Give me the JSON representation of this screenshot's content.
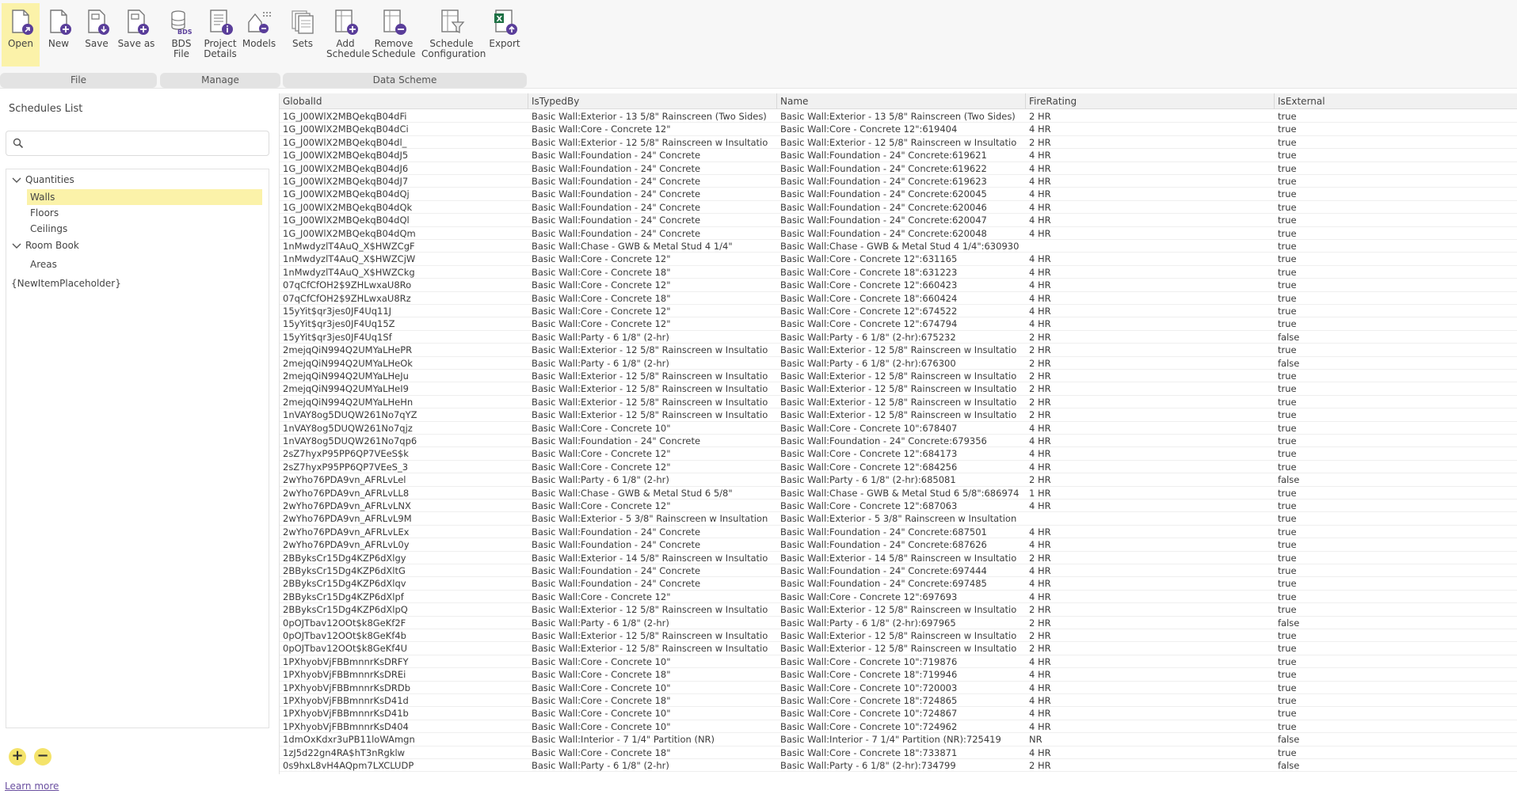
{
  "ribbon": {
    "tools": [
      {
        "name": "open",
        "label": "Open",
        "icon": "open-file-icon"
      },
      {
        "name": "new",
        "label": "New",
        "icon": "new-file-icon"
      },
      {
        "name": "save",
        "label": "Save",
        "icon": "save-icon"
      },
      {
        "name": "save-as",
        "label": "Save as",
        "icon": "save-as-icon"
      },
      {
        "name": "bds-file",
        "label": "BDS\nFile",
        "icon": "bds-database-icon"
      },
      {
        "name": "project-details",
        "label": "Project\nDetails",
        "icon": "project-details-icon"
      },
      {
        "name": "models",
        "label": "Models",
        "icon": "models-icon"
      },
      {
        "name": "sets",
        "label": "Sets",
        "icon": "sets-icon"
      },
      {
        "name": "add-schedule",
        "label": "Add\nSchedule",
        "icon": "add-schedule-icon"
      },
      {
        "name": "remove-schedule",
        "label": "Remove\nSchedule",
        "icon": "remove-schedule-icon"
      },
      {
        "name": "schedule-configuration",
        "label": "Schedule\nConfiguration",
        "icon": "schedule-configuration-icon"
      },
      {
        "name": "export",
        "label": "Export",
        "icon": "excel-export-icon"
      }
    ],
    "groups": [
      "File",
      "Manage",
      "Data Scheme"
    ]
  },
  "left_panel": {
    "title": "Schedules List",
    "search": {
      "value": "",
      "placeholder": ""
    },
    "tree": {
      "quantities": {
        "label": "Quantities",
        "children": [
          "Walls",
          "Floors",
          "Ceilings"
        ]
      },
      "room_book": {
        "label": "Room Book",
        "children": [
          "Areas"
        ]
      },
      "placeholder": "{NewItemPlaceholder}"
    },
    "selected": "Walls",
    "add_button": "+",
    "remove_button": "−",
    "learn_more": "Learn more"
  },
  "grid": {
    "columns": [
      "GlobalId",
      "IsTypedBy",
      "Name",
      "FireRating",
      "IsExternal"
    ],
    "rows": [
      [
        "1G_J00WlX2MBQekqB04dFi",
        "Basic Wall:Exterior - 13 5/8\" Rainscreen (Two Sides)",
        "Basic Wall:Exterior - 13 5/8\" Rainscreen (Two Sides)",
        "2 HR",
        "true"
      ],
      [
        "1G_J00WlX2MBQekqB04dCi",
        "Basic Wall:Core - Concrete 12\"",
        "Basic Wall:Core - Concrete 12\":619404",
        "4 HR",
        "true"
      ],
      [
        "1G_J00WlX2MBQekqB04dl_",
        "Basic Wall:Exterior - 12 5/8\" Rainscreen w Insultatio",
        "Basic Wall:Exterior - 12 5/8\" Rainscreen w Insultatio",
        "2 HR",
        "true"
      ],
      [
        "1G_J00WlX2MBQekqB04dJ5",
        "Basic Wall:Foundation - 24\" Concrete",
        "Basic Wall:Foundation - 24\" Concrete:619621",
        "4 HR",
        "true"
      ],
      [
        "1G_J00WlX2MBQekqB04dJ6",
        "Basic Wall:Foundation - 24\" Concrete",
        "Basic Wall:Foundation - 24\" Concrete:619622",
        "4 HR",
        "true"
      ],
      [
        "1G_J00WlX2MBQekqB04dJ7",
        "Basic Wall:Foundation - 24\" Concrete",
        "Basic Wall:Foundation - 24\" Concrete:619623",
        "4 HR",
        "true"
      ],
      [
        "1G_J00WlX2MBQekqB04dQj",
        "Basic Wall:Foundation - 24\" Concrete",
        "Basic Wall:Foundation - 24\" Concrete:620045",
        "4 HR",
        "true"
      ],
      [
        "1G_J00WlX2MBQekqB04dQk",
        "Basic Wall:Foundation - 24\" Concrete",
        "Basic Wall:Foundation - 24\" Concrete:620046",
        "4 HR",
        "true"
      ],
      [
        "1G_J00WlX2MBQekqB04dQl",
        "Basic Wall:Foundation - 24\" Concrete",
        "Basic Wall:Foundation - 24\" Concrete:620047",
        "4 HR",
        "true"
      ],
      [
        "1G_J00WlX2MBQekqB04dQm",
        "Basic Wall:Foundation - 24\" Concrete",
        "Basic Wall:Foundation - 24\" Concrete:620048",
        "4 HR",
        "true"
      ],
      [
        "1nMwdyzlT4AuQ_X$HWZCgF",
        "Basic Wall:Chase - GWB & Metal Stud 4 1/4\"",
        "Basic Wall:Chase - GWB & Metal Stud 4 1/4\":630930",
        "",
        "true"
      ],
      [
        "1nMwdyzlT4AuQ_X$HWZCjW",
        "Basic Wall:Core - Concrete 12\"",
        "Basic Wall:Core - Concrete 12\":631165",
        "4 HR",
        "true"
      ],
      [
        "1nMwdyzlT4AuQ_X$HWZCkg",
        "Basic Wall:Core - Concrete 18\"",
        "Basic Wall:Core - Concrete 18\":631223",
        "4 HR",
        "true"
      ],
      [
        "07qCfCfOH2$9ZHLwxaU8Ro",
        "Basic Wall:Core - Concrete 12\"",
        "Basic Wall:Core - Concrete 12\":660423",
        "4 HR",
        "true"
      ],
      [
        "07qCfCfOH2$9ZHLwxaU8Rz",
        "Basic Wall:Core - Concrete 18\"",
        "Basic Wall:Core - Concrete 18\":660424",
        "4 HR",
        "true"
      ],
      [
        "15yYit$qr3jes0JF4Uq11J",
        "Basic Wall:Core - Concrete 12\"",
        "Basic Wall:Core - Concrete 12\":674522",
        "4 HR",
        "true"
      ],
      [
        "15yYit$qr3jes0JF4Uq15Z",
        "Basic Wall:Core - Concrete 12\"",
        "Basic Wall:Core - Concrete 12\":674794",
        "4 HR",
        "true"
      ],
      [
        "15yYit$qr3jes0JF4Uq1Sf",
        "Basic Wall:Party - 6 1/8\" (2-hr)",
        "Basic Wall:Party - 6 1/8\" (2-hr):675232",
        "2 HR",
        "false"
      ],
      [
        "2mejqQiN994Q2UMYaLHePR",
        "Basic Wall:Exterior - 12 5/8\" Rainscreen w Insultatio",
        "Basic Wall:Exterior - 12 5/8\" Rainscreen w Insultatio",
        "2 HR",
        "true"
      ],
      [
        "2mejqQiN994Q2UMYaLHeOk",
        "Basic Wall:Party - 6 1/8\" (2-hr)",
        "Basic Wall:Party - 6 1/8\" (2-hr):676300",
        "2 HR",
        "false"
      ],
      [
        "2mejqQiN994Q2UMYaLHeJu",
        "Basic Wall:Exterior - 12 5/8\" Rainscreen w Insultatio",
        "Basic Wall:Exterior - 12 5/8\" Rainscreen w Insultatio",
        "2 HR",
        "true"
      ],
      [
        "2mejqQiN994Q2UMYaLHeI9",
        "Basic Wall:Exterior - 12 5/8\" Rainscreen w Insultatio",
        "Basic Wall:Exterior - 12 5/8\" Rainscreen w Insultatio",
        "2 HR",
        "true"
      ],
      [
        "2mejqQiN994Q2UMYaLHeHn",
        "Basic Wall:Exterior - 12 5/8\" Rainscreen w Insultatio",
        "Basic Wall:Exterior - 12 5/8\" Rainscreen w Insultatio",
        "2 HR",
        "true"
      ],
      [
        "1nVAY8og5DUQW261No7qYZ",
        "Basic Wall:Exterior - 12 5/8\" Rainscreen w Insultatio",
        "Basic Wall:Exterior - 12 5/8\" Rainscreen w Insultatio",
        "2 HR",
        "true"
      ],
      [
        "1nVAY8og5DUQW261No7qjz",
        "Basic Wall:Core - Concrete 10\"",
        "Basic Wall:Core - Concrete 10\":678407",
        "4 HR",
        "true"
      ],
      [
        "1nVAY8og5DUQW261No7qp6",
        "Basic Wall:Foundation - 24\" Concrete",
        "Basic Wall:Foundation - 24\" Concrete:679356",
        "4 HR",
        "true"
      ],
      [
        "2sZ7hyxP95PP6QP7VEeS$k",
        "Basic Wall:Core - Concrete 12\"",
        "Basic Wall:Core - Concrete 12\":684173",
        "4 HR",
        "true"
      ],
      [
        "2sZ7hyxP95PP6QP7VEeS_3",
        "Basic Wall:Core - Concrete 12\"",
        "Basic Wall:Core - Concrete 12\":684256",
        "4 HR",
        "true"
      ],
      [
        "2wYho76PDA9vn_AFRLvLel",
        "Basic Wall:Party - 6 1/8\" (2-hr)",
        "Basic Wall:Party - 6 1/8\" (2-hr):685081",
        "2 HR",
        "false"
      ],
      [
        "2wYho76PDA9vn_AFRLvLL8",
        "Basic Wall:Chase - GWB & Metal Stud 6 5/8\"",
        "Basic Wall:Chase - GWB & Metal Stud 6 5/8\":686974",
        "1 HR",
        "true"
      ],
      [
        "2wYho76PDA9vn_AFRLvLNX",
        "Basic Wall:Core - Concrete 12\"",
        "Basic Wall:Core - Concrete 12\":687063",
        "4 HR",
        "true"
      ],
      [
        "2wYho76PDA9vn_AFRLvL9M",
        "Basic Wall:Exterior - 5 3/8\" Rainscreen w Insultation",
        "Basic Wall:Exterior - 5 3/8\" Rainscreen w Insultation",
        "",
        "true"
      ],
      [
        "2wYho76PDA9vn_AFRLvLEx",
        "Basic Wall:Foundation - 24\" Concrete",
        "Basic Wall:Foundation - 24\" Concrete:687501",
        "4 HR",
        "true"
      ],
      [
        "2wYho76PDA9vn_AFRLvL0y",
        "Basic Wall:Foundation - 24\" Concrete",
        "Basic Wall:Foundation - 24\" Concrete:687626",
        "4 HR",
        "true"
      ],
      [
        "2BByksCr15Dg4KZP6dXlgy",
        "Basic Wall:Exterior - 14 5/8\" Rainscreen w Insultatio",
        "Basic Wall:Exterior - 14 5/8\" Rainscreen w Insultatio",
        "2 HR",
        "true"
      ],
      [
        "2BByksCr15Dg4KZP6dXltG",
        "Basic Wall:Foundation - 24\" Concrete",
        "Basic Wall:Foundation - 24\" Concrete:697444",
        "4 HR",
        "true"
      ],
      [
        "2BByksCr15Dg4KZP6dXlqv",
        "Basic Wall:Foundation - 24\" Concrete",
        "Basic Wall:Foundation - 24\" Concrete:697485",
        "4 HR",
        "true"
      ],
      [
        "2BByksCr15Dg4KZP6dXlpf",
        "Basic Wall:Core - Concrete 12\"",
        "Basic Wall:Core - Concrete 12\":697693",
        "4 HR",
        "true"
      ],
      [
        "2BByksCr15Dg4KZP6dXlpQ",
        "Basic Wall:Exterior - 12 5/8\" Rainscreen w Insultatio",
        "Basic Wall:Exterior - 12 5/8\" Rainscreen w Insultatio",
        "2 HR",
        "true"
      ],
      [
        "0pOJTbav12OOt$k8GeKf2F",
        "Basic Wall:Party - 6 1/8\" (2-hr)",
        "Basic Wall:Party - 6 1/8\" (2-hr):697965",
        "2 HR",
        "false"
      ],
      [
        "0pOJTbav12OOt$k8GeKf4b",
        "Basic Wall:Exterior - 12 5/8\" Rainscreen w Insultatio",
        "Basic Wall:Exterior - 12 5/8\" Rainscreen w Insultatio",
        "2 HR",
        "true"
      ],
      [
        "0pOJTbav12OOt$k8GeKf4U",
        "Basic Wall:Exterior - 12 5/8\" Rainscreen w Insultatio",
        "Basic Wall:Exterior - 12 5/8\" Rainscreen w Insultatio",
        "2 HR",
        "true"
      ],
      [
        "1PXhyobVjFBBmnnrKsDRFY",
        "Basic Wall:Core - Concrete 10\"",
        "Basic Wall:Core - Concrete 10\":719876",
        "4 HR",
        "true"
      ],
      [
        "1PXhyobVjFBBmnnrKsDREi",
        "Basic Wall:Core - Concrete 18\"",
        "Basic Wall:Core - Concrete 18\":719946",
        "4 HR",
        "true"
      ],
      [
        "1PXhyobVjFBBmnnrKsDRDb",
        "Basic Wall:Core - Concrete 10\"",
        "Basic Wall:Core - Concrete 10\":720003",
        "4 HR",
        "true"
      ],
      [
        "1PXhyobVjFBBmnnrKsD41d",
        "Basic Wall:Core - Concrete 18\"",
        "Basic Wall:Core - Concrete 18\":724865",
        "4 HR",
        "true"
      ],
      [
        "1PXhyobVjFBBmnnrKsD41b",
        "Basic Wall:Core - Concrete 10\"",
        "Basic Wall:Core - Concrete 10\":724867",
        "4 HR",
        "true"
      ],
      [
        "1PXhyobVjFBBmnnrKsD404",
        "Basic Wall:Core - Concrete 10\"",
        "Basic Wall:Core - Concrete 10\":724962",
        "4 HR",
        "true"
      ],
      [
        "1dmOxKdxr3uPB11loWAmgn",
        "Basic Wall:Interior - 7 1/4\" Partition (NR)",
        "Basic Wall:Interior - 7 1/4\" Partition (NR):725419",
        "NR",
        "false"
      ],
      [
        "1zJ5d22gn4RA$hT3nRgklw",
        "Basic Wall:Core - Concrete 18\"",
        "Basic Wall:Core - Concrete 18\":733871",
        "4 HR",
        "true"
      ],
      [
        "0s9hxL8vH4AQpm7LXCLUDP",
        "Basic Wall:Party - 6 1/8\" (2-hr)",
        "Basic Wall:Party - 6 1/8\" (2-hr):734799",
        "2 HR",
        "false"
      ]
    ]
  }
}
